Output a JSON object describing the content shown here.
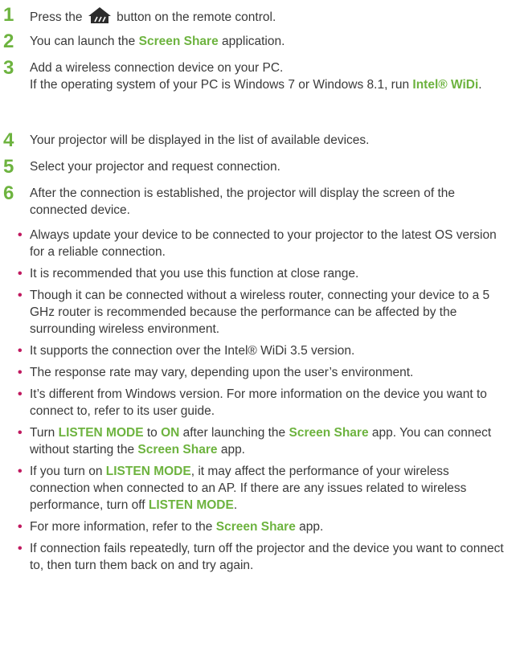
{
  "colors": {
    "accent": "#6db33f",
    "bullet": "#c0195f",
    "text": "#3a3a3a"
  },
  "steps": [
    {
      "num": "1",
      "before": "Press the ",
      "icon": "home-icon",
      "after": " button on the remote control."
    },
    {
      "num": "2",
      "before": "You can launch the ",
      "hl": "Screen Share",
      "after": " application."
    },
    {
      "num": "3",
      "line1": "Add a wireless connection device on your PC.",
      "line2": "If the operating system of your PC is Windows 7 or Windows 8.1, run ",
      "hl": "Intel® WiDi",
      "after": "."
    },
    {
      "num": "4",
      "text": "Your projector will be displayed in the list of available devices."
    },
    {
      "num": "5",
      "text": "Select your projector and request connection."
    },
    {
      "num": "6",
      "text": "After the connection is established, the projector will display the screen of the connected device."
    }
  ],
  "notes": [
    {
      "text": "Always update your device to be connected to your projector to the latest OS version for a reliable connection."
    },
    {
      "text": "It is recommended that you use this function at close range."
    },
    {
      "text": "Though it can be connected without a wireless router, connecting your device to a 5 GHz router is recommended because the performance can be affected by the surrounding wireless environment."
    },
    {
      "text": "It supports the connection over the Intel® WiDi 3.5 version."
    },
    {
      "text": "The response rate may vary, depending upon the user’s environment."
    },
    {
      "text": "It’s different from Windows version. For more information on the device you want to connect to, refer to its user guide."
    },
    {
      "p1": "Turn ",
      "h1": "LISTEN MODE",
      "p2": " to ",
      "h2": "ON",
      "p3": " after launching the ",
      "h3": "Screen Share",
      "p4": " app. You can connect without starting the ",
      "h4": "Screen Share",
      "p5": " app."
    },
    {
      "p1": "If you turn on ",
      "h1": "LISTEN MODE",
      "p2": ", it may affect the performance of your wireless connection when connected to an AP. If there are any issues related to wireless performance, turn off ",
      "h2": "LISTEN MODE",
      "p3": "."
    },
    {
      "p1": "For more information, refer to the ",
      "h1": "Screen Share",
      "p2": " app."
    },
    {
      "text": "If connection fails repeatedly, turn off the projector and the device you want to connect to, then turn them back on and try again."
    }
  ]
}
